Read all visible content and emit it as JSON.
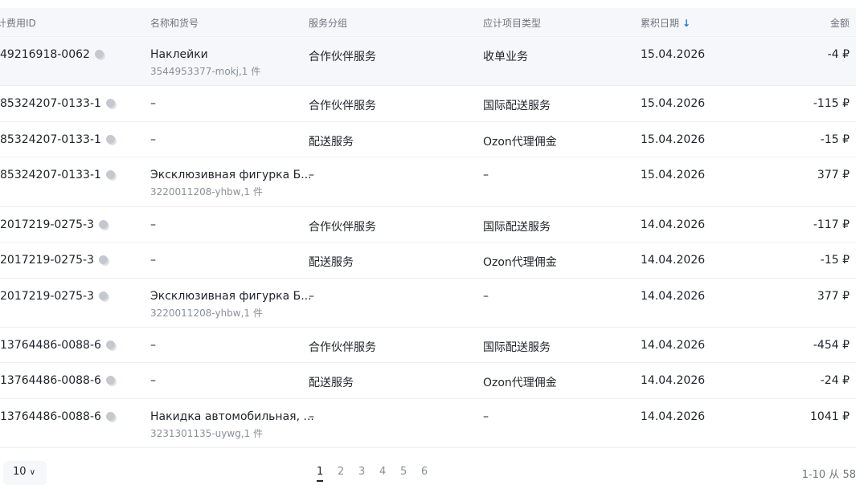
{
  "columns": [
    "计费用ID",
    "名称和货号",
    "服务分组",
    "应计项目类型",
    "累积日期",
    "金额"
  ],
  "sort_icon": "arrow-down-icon",
  "rows": [
    {
      "id": "49216918-0062",
      "name": "Наклейки",
      "sku": "3544953377-mokj,1 件",
      "group": "合作伙伴服务",
      "type": "收单业务",
      "date": "15.04.2026",
      "amount": "-4 ₽"
    },
    {
      "id": "85324207-0133-1",
      "name": "–",
      "sku": "",
      "group": "合作伙伴服务",
      "type": "国际配送服务",
      "date": "15.04.2026",
      "amount": "-115 ₽"
    },
    {
      "id": "85324207-0133-1",
      "name": "–",
      "sku": "",
      "group": "配送服务",
      "type": "Ozon代理佣金",
      "date": "15.04.2026",
      "amount": "-15 ₽"
    },
    {
      "id": "85324207-0133-1",
      "name": "Эксклюзивная фигурка Б...",
      "sku": "3220011208-yhbw,1 件",
      "group": "–",
      "type": "–",
      "date": "15.04.2026",
      "amount": "377 ₽"
    },
    {
      "id": "2017219-0275-3",
      "name": "–",
      "sku": "",
      "group": "合作伙伴服务",
      "type": "国际配送服务",
      "date": "14.04.2026",
      "amount": "-117 ₽"
    },
    {
      "id": "2017219-0275-3",
      "name": "–",
      "sku": "",
      "group": "配送服务",
      "type": "Ozon代理佣金",
      "date": "14.04.2026",
      "amount": "-15 ₽"
    },
    {
      "id": "2017219-0275-3",
      "name": "Эксклюзивная фигурка Б...",
      "sku": "3220011208-yhbw,1 件",
      "group": "–",
      "type": "–",
      "date": "14.04.2026",
      "amount": "377 ₽"
    },
    {
      "id": "13764486-0088-6",
      "name": "–",
      "sku": "",
      "group": "合作伙伴服务",
      "type": "国际配送服务",
      "date": "14.04.2026",
      "amount": "-454 ₽"
    },
    {
      "id": "13764486-0088-6",
      "name": "–",
      "sku": "",
      "group": "配送服务",
      "type": "Ozon代理佣金",
      "date": "14.04.2026",
      "amount": "-24 ₽"
    },
    {
      "id": "13764486-0088-6",
      "name": "Накидка автомобильная, ...",
      "sku": "3231301135-uywg,1 件",
      "group": "–",
      "type": "–",
      "date": "14.04.2026",
      "amount": "1041 ₽"
    }
  ],
  "pager": {
    "page_size": "10",
    "pages": [
      "1",
      "2",
      "3",
      "4",
      "5",
      "6"
    ],
    "current": "1",
    "count": "1-10 从 58"
  }
}
